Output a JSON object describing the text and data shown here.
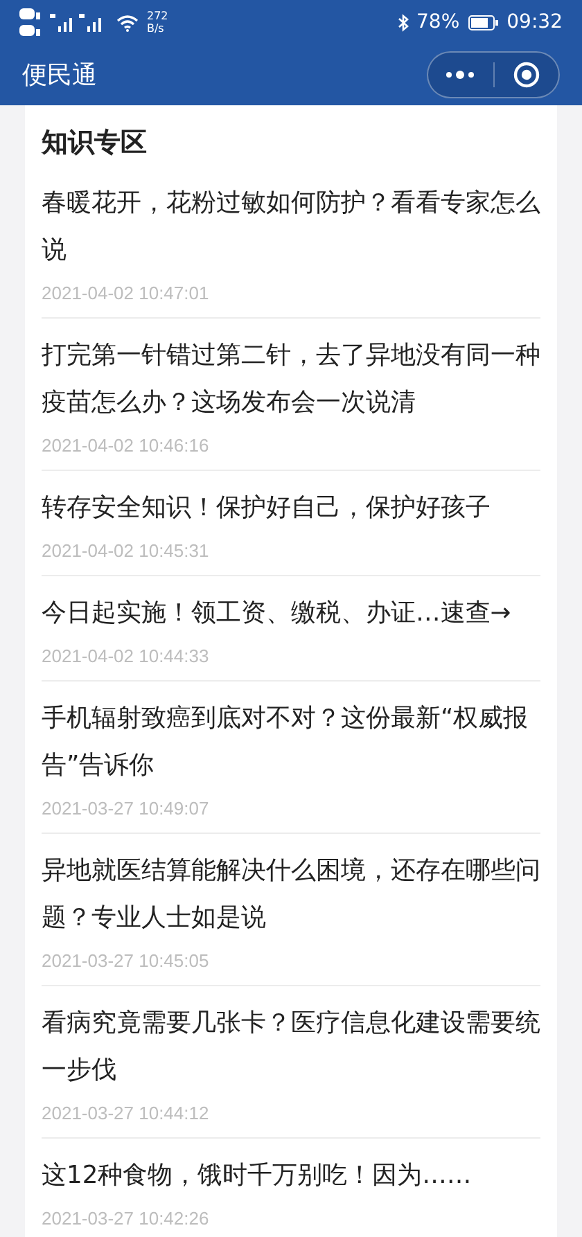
{
  "status_bar": {
    "network_speed": "272",
    "network_unit": "B/s",
    "battery": "78%",
    "time": "09:32"
  },
  "nav_bar": {
    "title": "便民通"
  },
  "section": {
    "title": "知识专区",
    "articles": [
      {
        "title": "春暖花开，花粉过敏如何防护？看看专家怎么说",
        "date": "2021-04-02 10:47:01"
      },
      {
        "title": "打完第一针错过第二针，去了异地没有同一种疫苗怎么办？这场发布会一次说清",
        "date": "2021-04-02 10:46:16"
      },
      {
        "title": "转存安全知识！保护好自己，保护好孩子",
        "date": "2021-04-02 10:45:31"
      },
      {
        "title": "今日起实施！领工资、缴税、办证…速查→",
        "date": "2021-04-02 10:44:33"
      },
      {
        "title": "手机辐射致癌到底对不对？这份最新“权威报告”告诉你",
        "date": "2021-03-27 10:49:07"
      },
      {
        "title": "异地就医结算能解决什么困境，还存在哪些问题？专业人士如是说",
        "date": "2021-03-27 10:45:05"
      },
      {
        "title": "看病究竟需要几张卡？医疗信息化建设需要统一步伐",
        "date": "2021-03-27 10:44:12"
      },
      {
        "title": "这12种食物，饿时千万别吃！因为……",
        "date": "2021-03-27 10:42:26"
      }
    ]
  }
}
